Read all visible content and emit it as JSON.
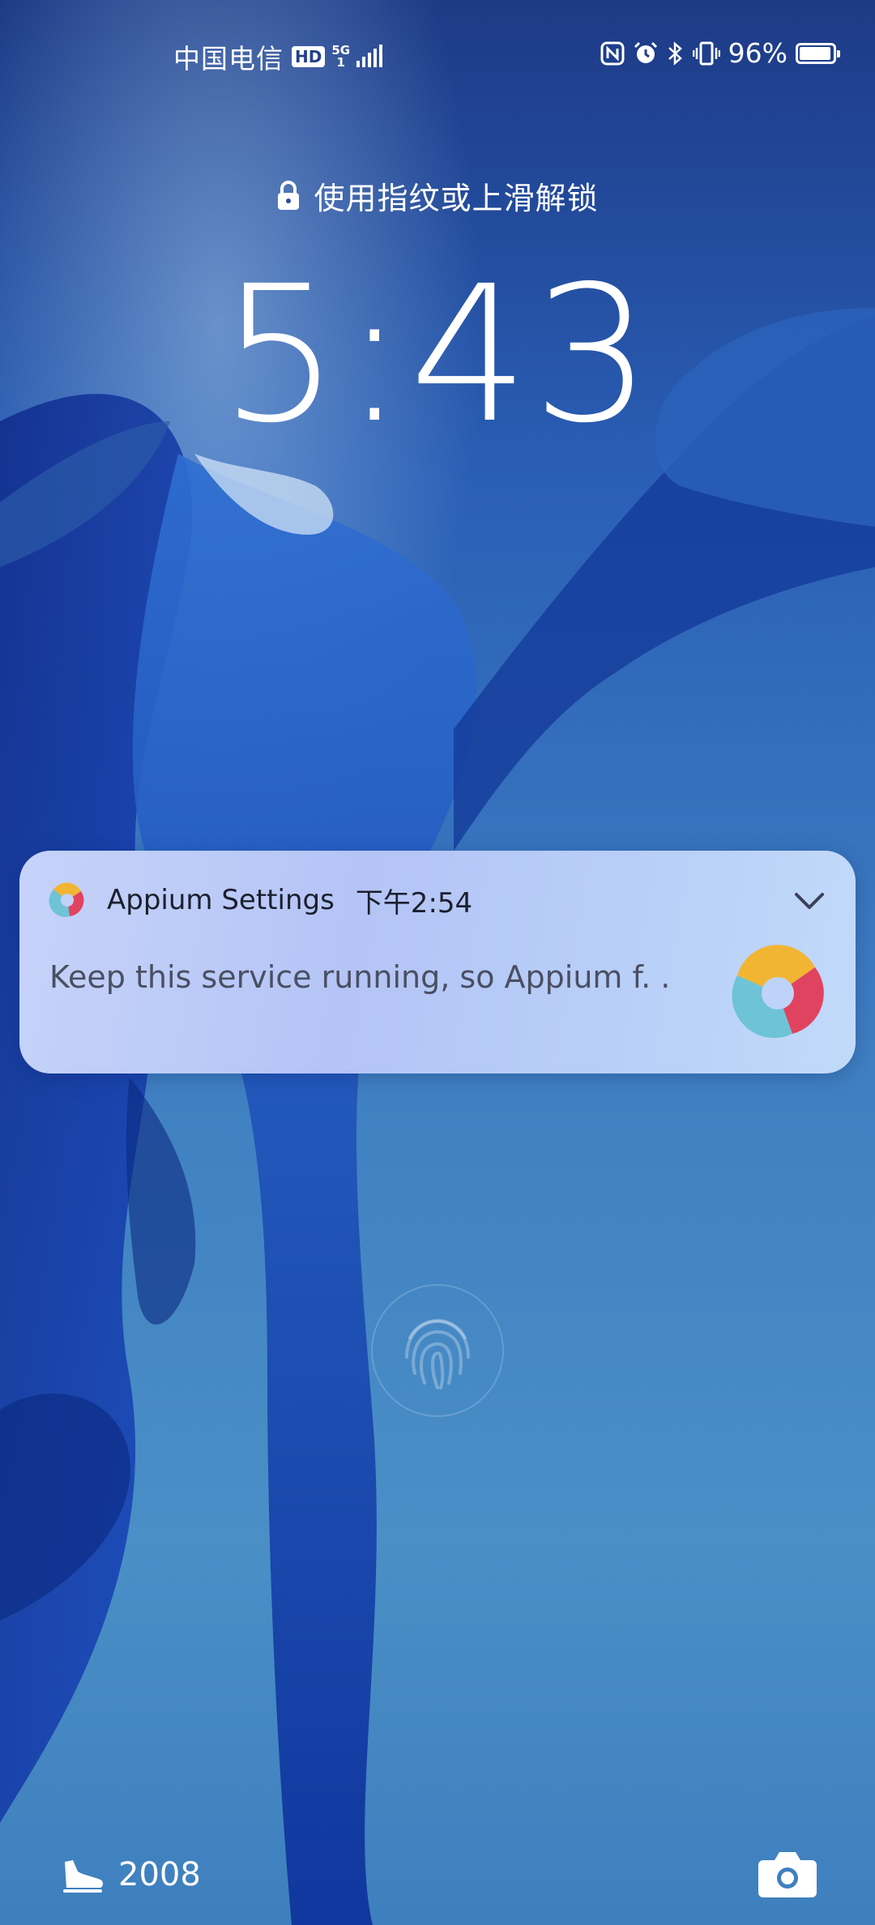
{
  "status_bar": {
    "carrier": "中国电信",
    "hd_badge": "HD",
    "network_type_top": "5G",
    "network_type_bottom": "1",
    "battery_percent": "96%",
    "battery_level": 0.96,
    "icons": [
      "signal-bars-icon",
      "nfc-icon",
      "alarm-icon",
      "bluetooth-icon",
      "vibrate-icon",
      "battery-charging-icon"
    ]
  },
  "lock_screen": {
    "unlock_hint": "使用指纹或上滑解锁",
    "clock": "5:43"
  },
  "notification": {
    "app_name": "Appium Settings",
    "time": "下午2:54",
    "body": "Keep this service running, so Appium f. .",
    "icons": [
      "appium-logo-icon",
      "chevron-down-icon"
    ]
  },
  "bottom_bar": {
    "step_count": "2008",
    "icons": [
      "sneaker-icon",
      "camera-icon",
      "fingerprint-icon"
    ]
  },
  "colors": {
    "notification_bg": "#b9c9f7",
    "wallpaper_top": "#1d3a86",
    "wallpaper_bottom": "#4a8fc6"
  }
}
